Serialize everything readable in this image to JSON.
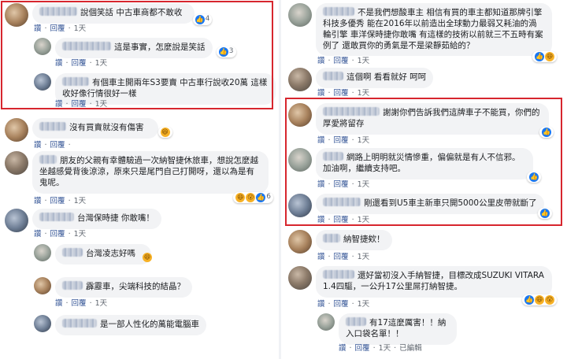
{
  "labels": {
    "like": "讚",
    "reply": "回覆",
    "dot": "·",
    "edited": "已編輯"
  },
  "left": [
    {
      "text": "說個笑話  中古車商都不敢收",
      "reactions": [
        "like"
      ],
      "count": "4",
      "time": "1天"
    },
    {
      "text": "這是事實，怎麼說是笑話",
      "reactions": [
        "like"
      ],
      "count": "3",
      "time": "1天"
    },
    {
      "text": "有個車主開兩年S3要賣  中古車行說收20萬  這樣收好像行情很好一樣",
      "reactions": [],
      "count": "",
      "time": "1天"
    },
    {
      "text": "沒有買賣就沒有傷害",
      "reactions": [
        "haha"
      ],
      "count": "",
      "time": ""
    },
    {
      "text": "朋友的父親有幸體驗過一次納智捷休旅車，想說怎麼越坐越感覺背後涼涼，原來只是尾門自己打開呀，還以為是有鬼呢。",
      "reactions": [
        "haha",
        "wow",
        "like"
      ],
      "count": "6",
      "time": "1天"
    },
    {
      "text": "台灣保時捷 你敢嘴！",
      "reactions": [],
      "count": "",
      "time": "1天"
    },
    {
      "text": "台灣凌志好嗎",
      "reactions": [
        "haha"
      ],
      "count": "",
      "time": ""
    },
    {
      "text": "霹靂車，尖端科技的結晶？",
      "reactions": [],
      "count": "",
      "time": "1天"
    },
    {
      "text": "是一部人性化的萬能電腦車",
      "reactions": [],
      "count": "",
      "time": ""
    }
  ],
  "right": [
    {
      "text": "不是我們想酸車主  相信有買的車主都知道那牌引擎科技多優秀  能在2016年以前造出全球動力最弱又耗油的渦輪引擎  車洋保時捷你敢嘴  有這樣的技術以前就三不五時有案例了  還敢買你的勇氣是不是梁靜茹給的？",
      "reactions": [
        "like",
        "haha"
      ],
      "count": "",
      "time": "1天"
    },
    {
      "text": "這個啊  看看就好  呵呵",
      "reactions": [],
      "count": "",
      "time": "1天"
    },
    {
      "text": "謝謝你們告訴我們這牌車子不能買，你們的厚愛將留存",
      "reactions": [
        "like"
      ],
      "count": "",
      "time": "1天"
    },
    {
      "text": "網路上明明就災情慘重，偏偏就是有人不信邪。加油啊，繼續支持吧。",
      "reactions": [
        "like"
      ],
      "count": "",
      "time": "1天"
    },
    {
      "text": "剛還看到U5車主新車只開5000公里皮帶就斷了",
      "reactions": [
        "like"
      ],
      "count": "",
      "time": "1天"
    },
    {
      "text": "納智捷欸！",
      "reactions": [],
      "count": "",
      "time": "1天"
    },
    {
      "text": "還好當初沒入手納智捷，目標改成SUZUKI VITARA 1.4四驅，一公升17公里屌打納智捷。",
      "reactions": [
        "like",
        "haha",
        "wow"
      ],
      "count": "",
      "time": "1天"
    },
    {
      "text": "有17這麼厲害！！納入口袋名單！！",
      "reactions": [],
      "count": "",
      "time": "1天"
    }
  ]
}
